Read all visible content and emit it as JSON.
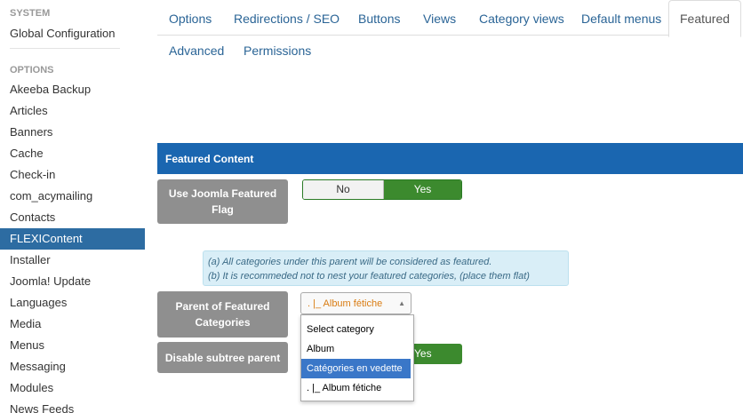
{
  "sidebar": {
    "system_heading": "SYSTEM",
    "global_config": "Global Configuration",
    "options_heading": "OPTIONS",
    "items": [
      {
        "label": "Akeeba Backup"
      },
      {
        "label": "Articles"
      },
      {
        "label": "Banners"
      },
      {
        "label": "Cache"
      },
      {
        "label": "Check-in"
      },
      {
        "label": "com_acymailing"
      },
      {
        "label": "Contacts"
      },
      {
        "label": "FLEXIContent",
        "active": true
      },
      {
        "label": "Installer"
      },
      {
        "label": "Joomla! Update"
      },
      {
        "label": "Languages"
      },
      {
        "label": "Media"
      },
      {
        "label": "Menus"
      },
      {
        "label": "Messaging"
      },
      {
        "label": "Modules"
      },
      {
        "label": "News Feeds"
      }
    ]
  },
  "tabs": [
    {
      "label": "Options"
    },
    {
      "label": "Redirections / SEO"
    },
    {
      "label": "Buttons"
    },
    {
      "label": "Views"
    },
    {
      "label": "Category views"
    },
    {
      "label": "Default menus"
    },
    {
      "label": "Featured",
      "active": true
    },
    {
      "label": "Advanced"
    },
    {
      "label": "Permissions"
    }
  ],
  "section": {
    "title": "Featured Content"
  },
  "fields": {
    "use_joomla_featured": {
      "label": "Use Joomla Featured Flag",
      "no": "No",
      "yes": "Yes",
      "value": "Yes"
    },
    "note_lines": [
      "(a) All categories under this parent will be considered as featured.",
      "(b) It is recommeded not to nest your featured categories, (place them flat)"
    ],
    "parent_featured": {
      "label": "Parent of Featured Categories",
      "selected": ". |_ Album fétiche",
      "options": [
        {
          "label": "Select category"
        },
        {
          "label": "Album"
        },
        {
          "label": "Catégories en vedette",
          "highlighted": true
        },
        {
          "label": ". |_ Album fétiche"
        }
      ]
    },
    "disable_subtree": {
      "label": "Disable subtree parent",
      "yes": "Yes"
    }
  },
  "colors": {
    "accent": "#1a66b0",
    "active_sidebar": "#2d6ca2",
    "yes_green": "#3c8a2e",
    "label_gray": "#8f8f8f",
    "select_orange": "#d97c12"
  }
}
